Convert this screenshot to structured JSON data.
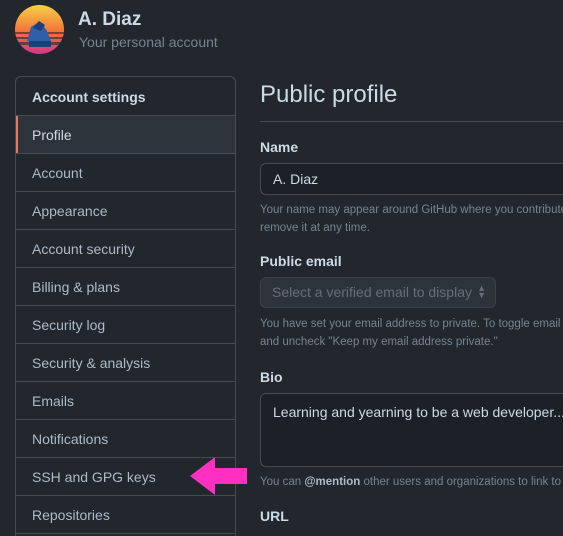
{
  "user": {
    "name": "A. Diaz",
    "subtitle": "Your personal account"
  },
  "sidebar": {
    "header": "Account settings",
    "selected": "Profile",
    "items": [
      {
        "label": "Profile"
      },
      {
        "label": "Account"
      },
      {
        "label": "Appearance"
      },
      {
        "label": "Account security"
      },
      {
        "label": "Billing & plans"
      },
      {
        "label": "Security log"
      },
      {
        "label": "Security & analysis"
      },
      {
        "label": "Emails"
      },
      {
        "label": "Notifications"
      },
      {
        "label": "SSH and GPG keys"
      },
      {
        "label": "Repositories"
      }
    ]
  },
  "annotation": {
    "arrow_color": "#ff2fbf",
    "points_to": "SSH and GPG keys"
  },
  "main": {
    "title": "Public profile",
    "name_label": "Name",
    "name_value": "A. Diaz",
    "name_note_line1": "Your name may appear around GitHub where you contribute",
    "name_note_line2": "remove it at any time.",
    "email_label": "Public email",
    "email_select": "Select a verified email to display",
    "email_note_line1": "You have set your email address to private. To toggle email",
    "email_note_line2": "and uncheck \"Keep my email address private.\"",
    "bio_label": "Bio",
    "bio_value": "Learning and yearning to be a web developer...",
    "bio_note_prefix": "You can ",
    "bio_note_mention": "@mention",
    "bio_note_suffix": " other users and organizations to link to",
    "url_label": "URL"
  },
  "colors": {
    "background": "#22272e",
    "selected_indicator": "#ec775c",
    "border": "#444c56"
  }
}
